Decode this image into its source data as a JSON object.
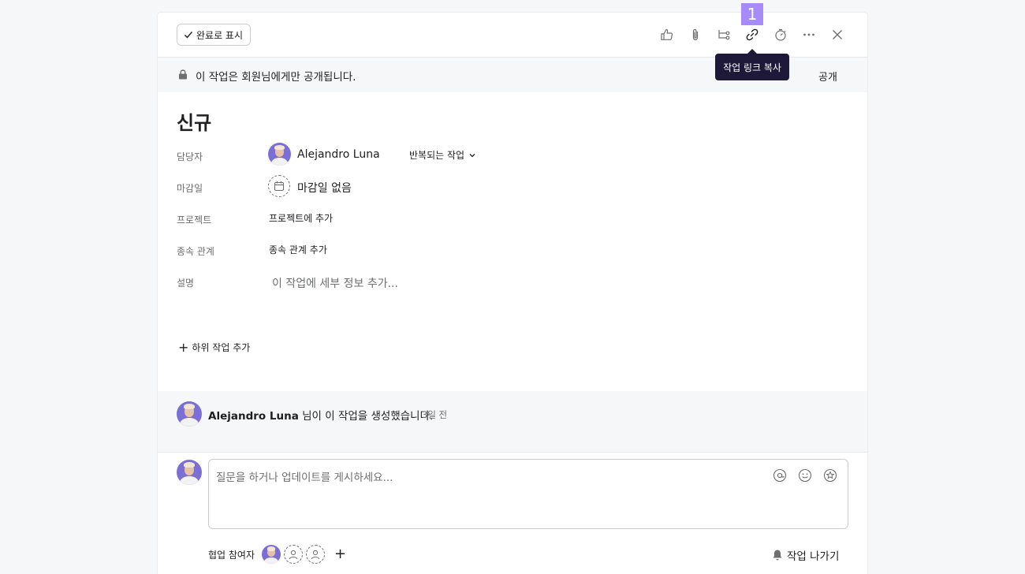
{
  "toolbar": {
    "complete_label": "완료로 표시",
    "icons": [
      "thumbs-up-icon",
      "paperclip-icon",
      "subtask-icon",
      "link-icon",
      "timer-icon",
      "more-icon",
      "close-icon"
    ]
  },
  "badge": "1",
  "tooltip": "작업 링크 복사",
  "privacy": {
    "message": "이 작업은 회원님에게만 공개됩니다.",
    "public_label": "공개"
  },
  "task": {
    "title": "신규",
    "fields": {
      "assignee_label": "담당자",
      "assignee_name": "Alejandro Luna",
      "recurring_label": "반복되는 작업",
      "due_label": "마감일",
      "due_value": "마감일 없음",
      "project_label": "프로젝트",
      "project_value": "프로젝트에 추가",
      "dependency_label": "종속 관계",
      "dependency_value": "종속 관계 추가",
      "description_label": "설명",
      "description_placeholder": "이 작업에 세부 정보 추가..."
    },
    "add_subtask": "하위 작업 추가"
  },
  "activity": {
    "author": "Alejandro Luna",
    "action": " 님이 이 작업을 생성했습니다.",
    "time": "3일 전"
  },
  "comment": {
    "placeholder": "질문을 하거나 업데이트를 게시하세요..."
  },
  "footer": {
    "collaborators_label": "협업 참여자",
    "add_collaborator": "+",
    "leave_label": "작업 나가기"
  }
}
